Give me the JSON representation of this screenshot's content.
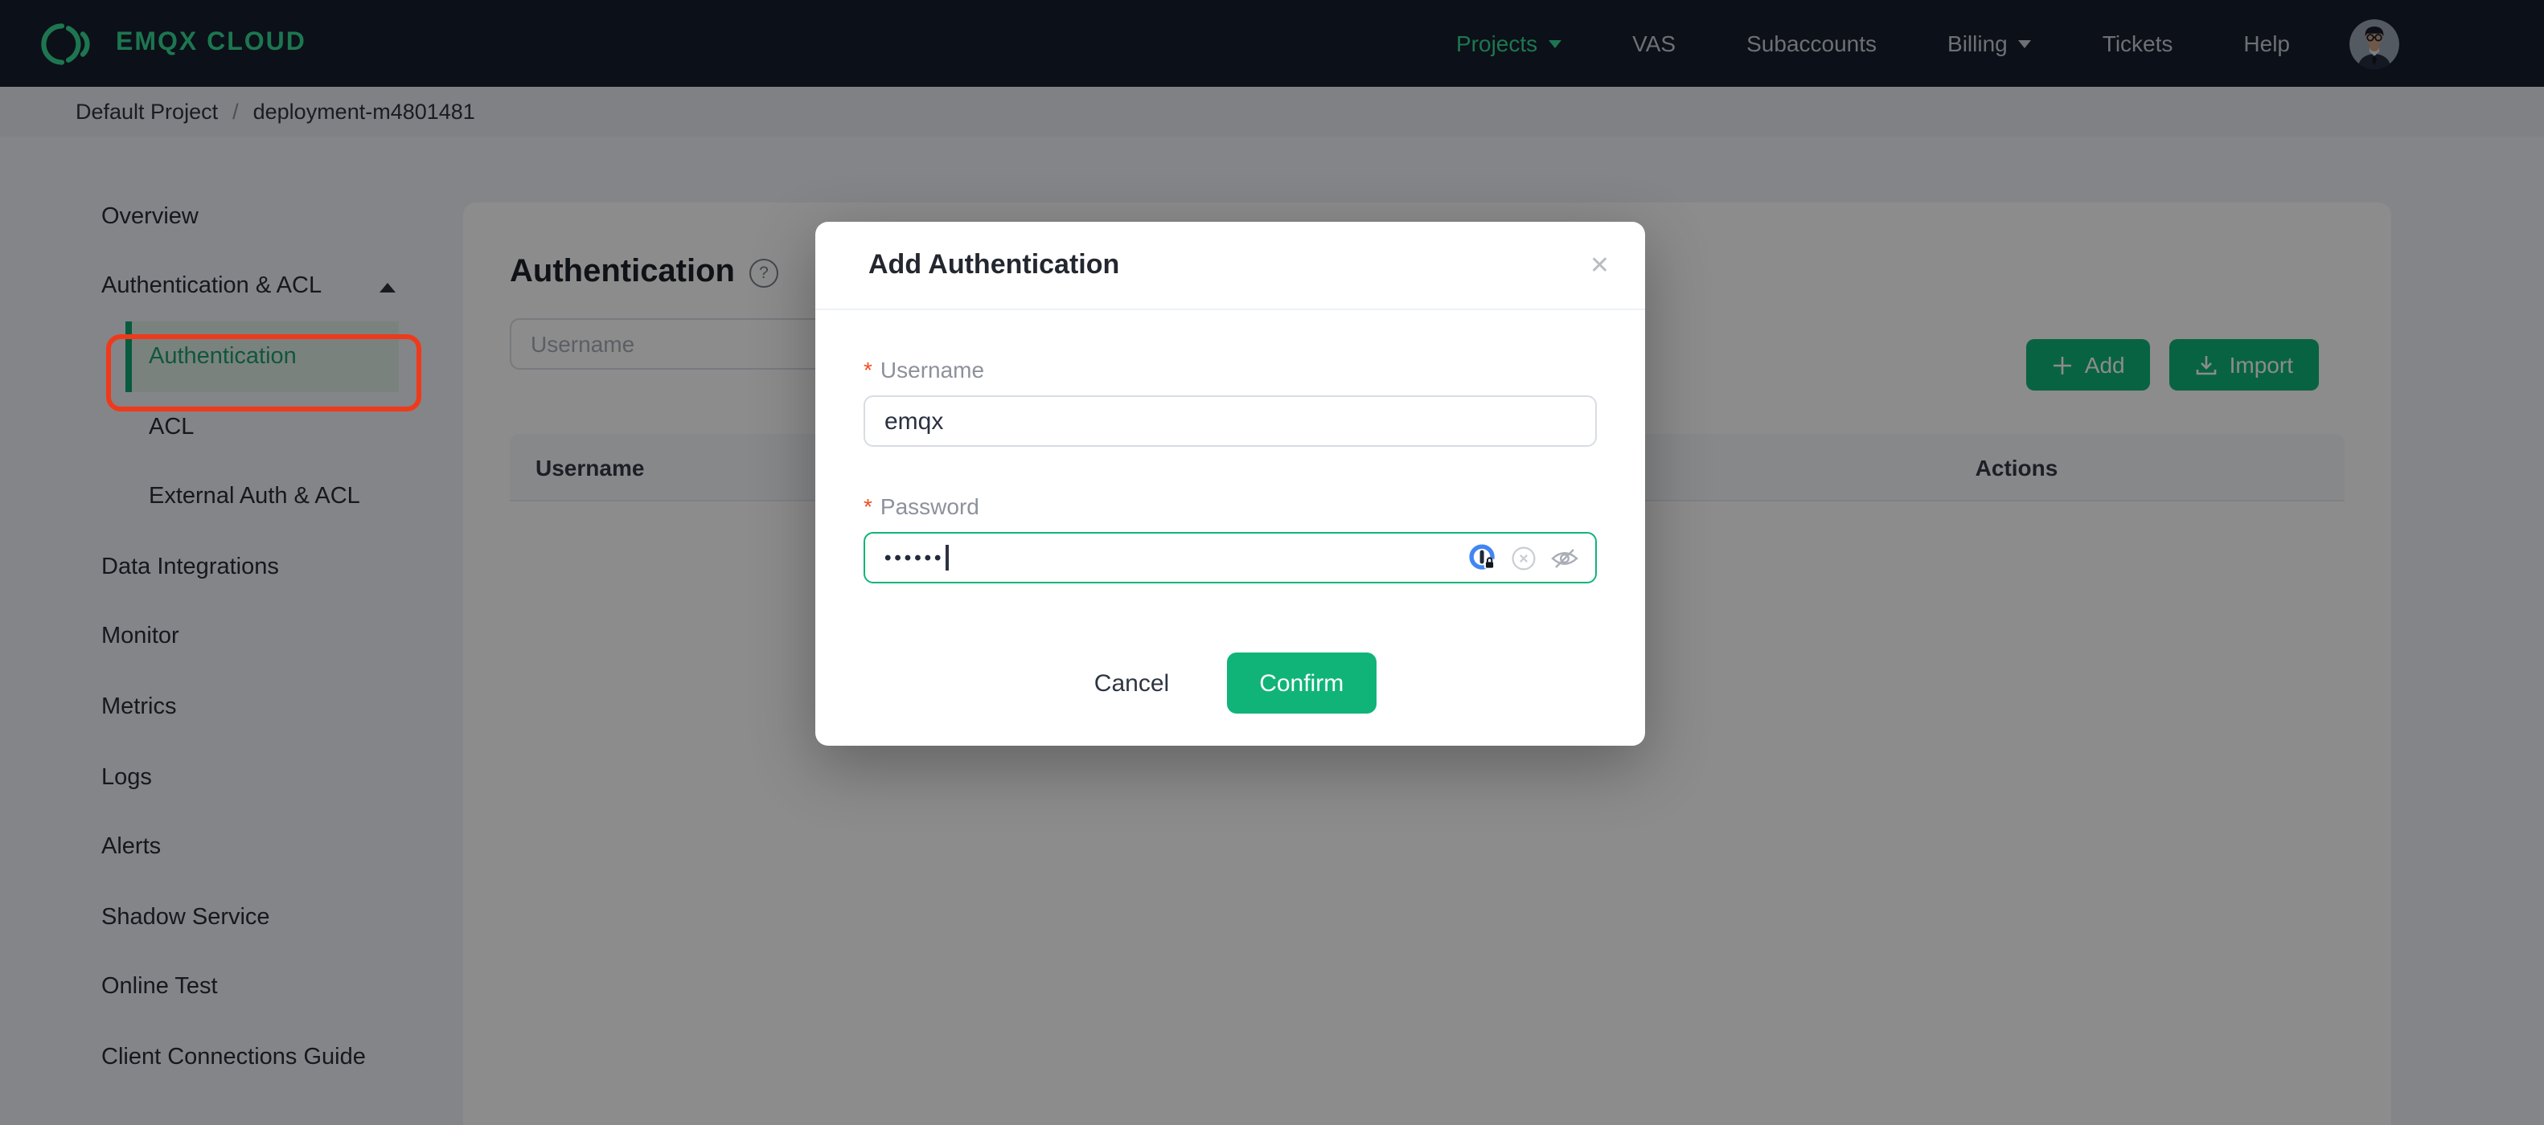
{
  "navbar": {
    "brand": "EMQX CLOUD",
    "items": [
      {
        "label": "Projects",
        "active": true,
        "caret": true
      },
      {
        "label": "VAS"
      },
      {
        "label": "Subaccounts"
      },
      {
        "label": "Billing",
        "caret": true
      },
      {
        "label": "Tickets"
      },
      {
        "label": "Help"
      }
    ]
  },
  "breadcrumb": {
    "items": [
      "Default Project",
      "deployment-m4801481"
    ],
    "separator": "/"
  },
  "sidebar": {
    "items": [
      {
        "label": "Overview",
        "type": "top"
      },
      {
        "label": "Authentication & ACL",
        "type": "top",
        "expanded": true
      },
      {
        "label": "Authentication",
        "type": "sub",
        "selected": true,
        "annotated": true
      },
      {
        "label": "ACL",
        "type": "sub"
      },
      {
        "label": "External Auth & ACL",
        "type": "sub"
      },
      {
        "label": "Data Integrations",
        "type": "top"
      },
      {
        "label": "Monitor",
        "type": "top"
      },
      {
        "label": "Metrics",
        "type": "top"
      },
      {
        "label": "Logs",
        "type": "top"
      },
      {
        "label": "Alerts",
        "type": "top"
      },
      {
        "label": "Shadow Service",
        "type": "top"
      },
      {
        "label": "Online Test",
        "type": "top"
      },
      {
        "label": "Client Connections Guide",
        "type": "top"
      }
    ]
  },
  "main": {
    "title": "Authentication",
    "help_glyph": "?",
    "search": {
      "placeholder": "Username"
    },
    "buttons": {
      "add": "Add",
      "import": "Import"
    },
    "table": {
      "columns": [
        "Username",
        "Actions"
      ]
    }
  },
  "modal": {
    "title": "Add Authentication",
    "close_glyph": "✕",
    "required_marker": "*",
    "fields": [
      {
        "label": "Username",
        "required": true,
        "value": "emqx"
      },
      {
        "label": "Password",
        "required": true,
        "display": "••••••",
        "masked": true
      }
    ],
    "buttons": {
      "cancel": "Cancel",
      "confirm": "Confirm"
    }
  },
  "colors": {
    "brand_green": "#35d893",
    "button_green": "#10b478",
    "selected_green": "#0da771",
    "annotation_red": "#ee3a1b",
    "required_red": "#f04e22",
    "navbar_bg": "#161e2d",
    "overlay": "rgba(0,0,0,0.45)"
  }
}
